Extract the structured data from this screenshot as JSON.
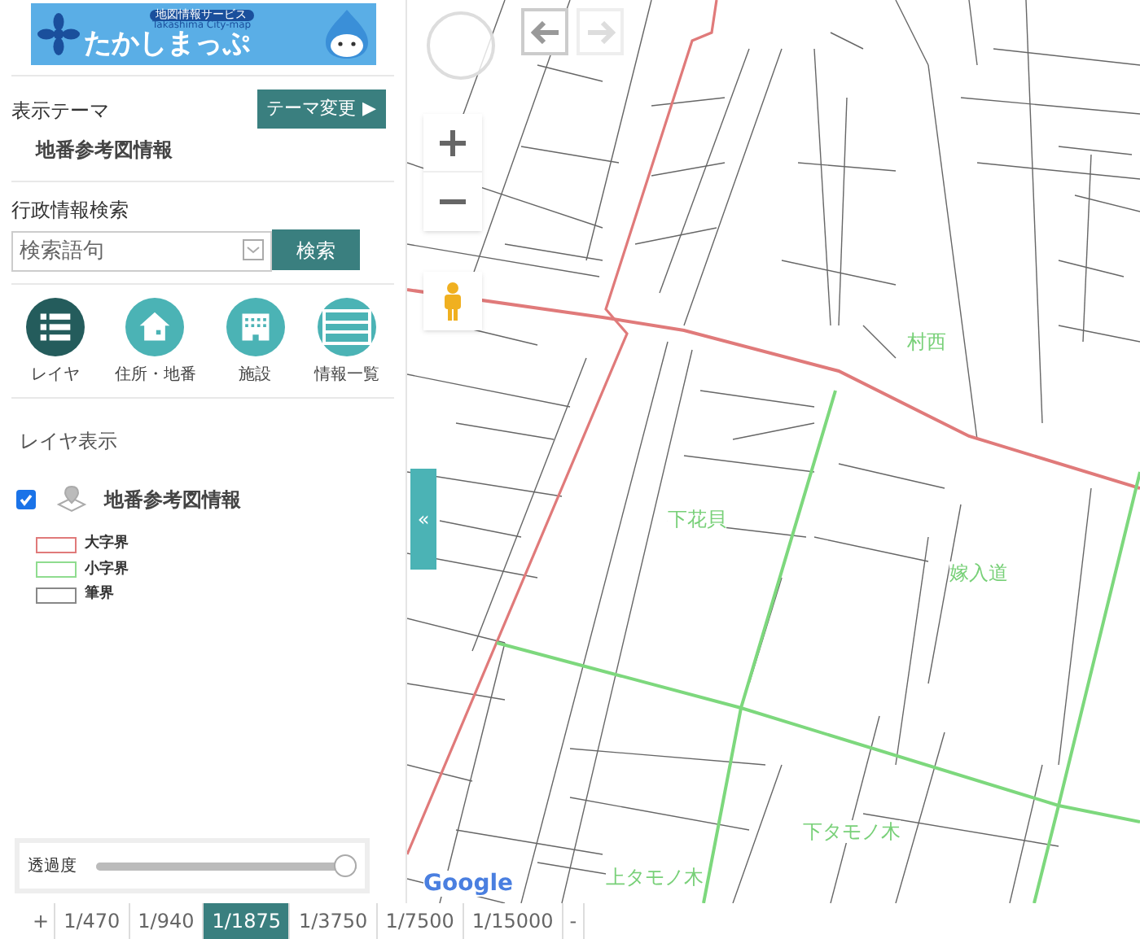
{
  "logo": {
    "tagline": "地図情報サービス",
    "subtitle": "Takashima City-map",
    "title": "たかしまっぷ"
  },
  "theme": {
    "label": "表示テーマ",
    "button": "テーマ変更",
    "button_arrow": "▶",
    "current": "地番参考図情報"
  },
  "search": {
    "label": "行政情報検索",
    "placeholder": "検索語句",
    "button": "検索"
  },
  "nav": [
    {
      "kind": "layers",
      "label": "レイヤ",
      "selected": true
    },
    {
      "kind": "home",
      "label": "住所・地番",
      "selected": false
    },
    {
      "kind": "building",
      "label": "施設",
      "selected": false
    },
    {
      "kind": "list",
      "label": "情報一覧",
      "selected": false
    }
  ],
  "layers": {
    "title": "レイヤ表示",
    "items": [
      {
        "label": "地番参考図情報",
        "checked": true
      }
    ],
    "legend": [
      {
        "label": "大字界",
        "color": "#e07a7a"
      },
      {
        "label": "小字界",
        "color": "#8fdc8f"
      },
      {
        "label": "筆界",
        "color": "#888888"
      }
    ]
  },
  "opacity": {
    "label": "透過度",
    "level": 1
  },
  "map": {
    "history": {
      "back_disabled": false,
      "forward_disabled": true
    },
    "collapse": "«",
    "labels": [
      "村西",
      "下花貝",
      "嫁入道",
      "下タモノ木",
      "上タモノ木"
    ],
    "attribution": "Google"
  },
  "scale": {
    "zoom_in": "+",
    "zoom_out": "-",
    "options": [
      {
        "label": "1/470",
        "selected": false
      },
      {
        "label": "1/940",
        "selected": false
      },
      {
        "label": "1/1875",
        "selected": true
      },
      {
        "label": "1/3750",
        "selected": false
      },
      {
        "label": "1/7500",
        "selected": false
      },
      {
        "label": "1/15000",
        "selected": false
      }
    ]
  }
}
